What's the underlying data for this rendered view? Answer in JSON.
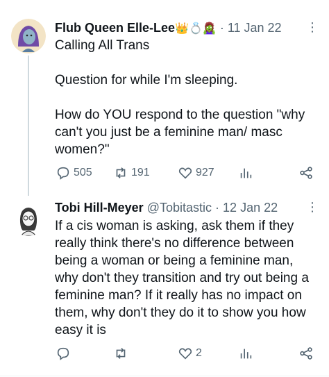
{
  "tweets": [
    {
      "author_name": "Flub Queen Elle-Lee",
      "author_emoji": "👑💍🧟‍♀️",
      "separator": "·",
      "date": "11 Jan 22",
      "more_label": "⋮",
      "text": "Calling All Trans\n\nQuestion for while I'm sleeping.\n\nHow do YOU respond to the question \"why can't you just be a feminine man/ masc women?\"",
      "replies": "505",
      "retweets": "191",
      "likes": "927"
    },
    {
      "author_name": "Tobi Hill-Meyer",
      "handle": "@Tobitastic",
      "separator": "·",
      "date": "12 Jan 22",
      "more_label": "⋮",
      "text": "If a cis woman is asking, ask them if they really think there's no difference between being a woman or being a feminine man, why don't they transition and try out being a feminine man? If it really has no impact on them, why don't they do it to show you how easy it is",
      "replies": "",
      "retweets": "",
      "likes": "2"
    }
  ],
  "colors": {
    "text": "#0f1419",
    "secondary": "#536471",
    "thread_line": "#cfd9de"
  }
}
